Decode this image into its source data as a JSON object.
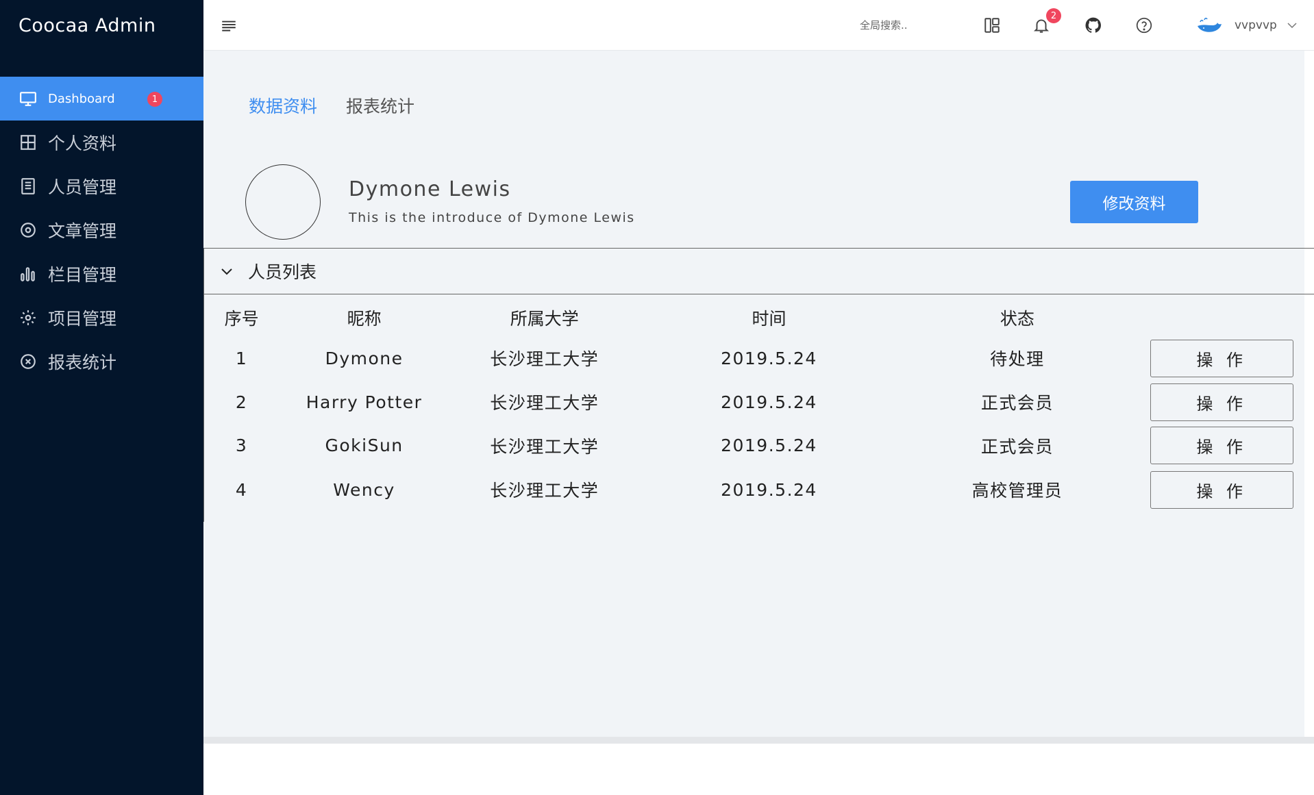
{
  "sidebar": {
    "brand": "Coocaa Admin",
    "items": [
      {
        "label": "Dashboard",
        "icon": "monitor-icon",
        "badge": "1",
        "active": true
      },
      {
        "label": "个人资料",
        "icon": "grid-icon"
      },
      {
        "label": "人员管理",
        "icon": "document-icon"
      },
      {
        "label": "文章管理",
        "icon": "target-icon"
      },
      {
        "label": "栏目管理",
        "icon": "bar-chart-icon"
      },
      {
        "label": "项目管理",
        "icon": "gear-icon"
      },
      {
        "label": "报表统计",
        "icon": "close-circle-icon"
      }
    ]
  },
  "header": {
    "search_placeholder": "全局搜索..",
    "notification_count": "2",
    "username": "vvpvvp"
  },
  "tabs": [
    {
      "label": "数据资料",
      "active": true
    },
    {
      "label": "报表统计",
      "active": false
    }
  ],
  "profile": {
    "name": "Dymone Lewis",
    "intro": "This is the introduce of Dymone Lewis",
    "edit_label": "修改资料"
  },
  "personnel": {
    "title": "人员列表",
    "columns": [
      "序号",
      "昵称",
      "所属大学",
      "时间",
      "状态"
    ],
    "rows": [
      {
        "index": "1",
        "nickname": "Dymone",
        "university": "长沙理工大学",
        "time": "2019.5.24",
        "status": "待处理",
        "action": "操 作"
      },
      {
        "index": "2",
        "nickname": "Harry Potter",
        "university": "长沙理工大学",
        "time": "2019.5.24",
        "status": "正式会员",
        "action": "操 作"
      },
      {
        "index": "3",
        "nickname": "GokiSun",
        "university": "长沙理工大学",
        "time": "2019.5.24",
        "status": "正式会员",
        "action": "操 作"
      },
      {
        "index": "4",
        "nickname": "Wency",
        "university": "长沙理工大学",
        "time": "2019.5.24",
        "status": "高校管理员",
        "action": "操 作"
      }
    ]
  },
  "colors": {
    "sidebar_bg": "#03152b",
    "accent": "#3f8ef0",
    "badge": "#f0465e",
    "content_bg": "#f1f4f7"
  }
}
